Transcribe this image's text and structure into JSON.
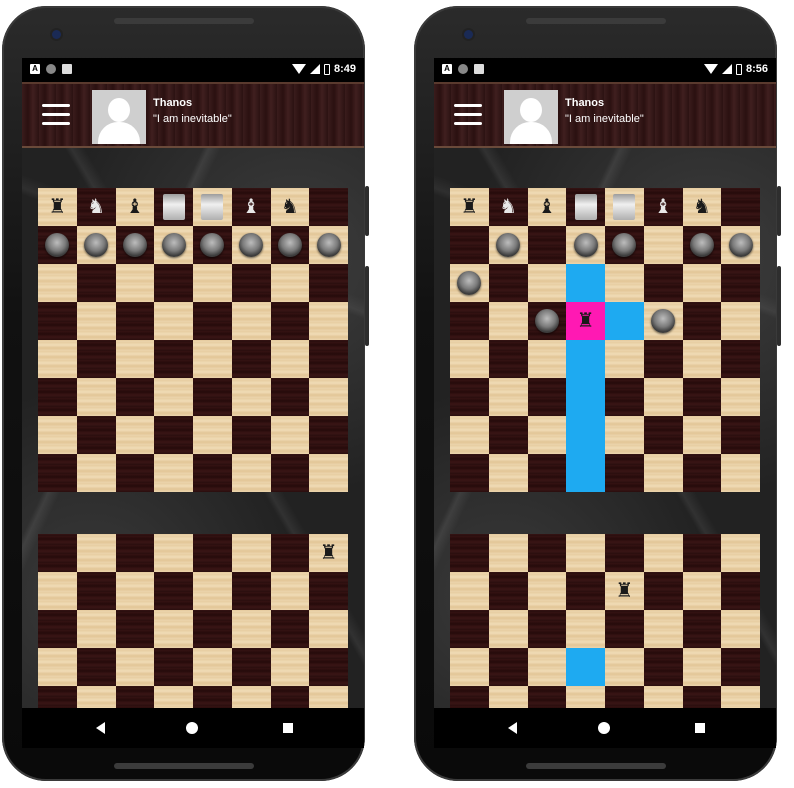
{
  "phones": [
    {
      "status": {
        "time": "8:49",
        "a_badge": "A"
      },
      "profile": {
        "name": "Thanos",
        "quote": "\"I am inevitable\""
      },
      "top_board": [
        [
          "rook",
          "bird",
          "bishop",
          "portrait",
          "portrait",
          "bishop",
          "bird",
          ""
        ],
        [
          "soldier",
          "soldier",
          "soldier",
          "soldier",
          "soldier",
          "soldier",
          "soldier",
          "soldier"
        ],
        [
          "",
          "",
          "",
          "",
          "",
          "",
          "",
          ""
        ],
        [
          "",
          "",
          "",
          "",
          "",
          "",
          "",
          ""
        ],
        [
          "",
          "",
          "",
          "",
          "",
          "",
          "",
          ""
        ],
        [
          "",
          "",
          "",
          "",
          "",
          "",
          "",
          ""
        ],
        [
          "",
          "",
          "",
          "",
          "",
          "",
          "",
          ""
        ],
        [
          "",
          "",
          "",
          "",
          "",
          "",
          "",
          ""
        ]
      ],
      "top_highlights": [],
      "bottom_board": [
        [
          "",
          "",
          "",
          "",
          "",
          "",
          "",
          "rook"
        ],
        [
          "",
          "",
          "",
          "",
          "",
          "",
          "",
          ""
        ],
        [
          "",
          "",
          "",
          "",
          "",
          "",
          "",
          ""
        ],
        [
          "",
          "",
          "",
          "",
          "",
          "",
          "",
          ""
        ],
        [
          "",
          "",
          "",
          "",
          "",
          "",
          "",
          ""
        ]
      ],
      "bottom_highlights": []
    },
    {
      "status": {
        "time": "8:56",
        "a_badge": "A"
      },
      "profile": {
        "name": "Thanos",
        "quote": "\"I am inevitable\""
      },
      "top_board": [
        [
          "rook",
          "bird",
          "bishop",
          "portrait",
          "portrait",
          "bishop",
          "bird",
          ""
        ],
        [
          "",
          "soldier",
          "",
          "soldier",
          "soldier",
          "",
          "soldier",
          "soldier"
        ],
        [
          "soldier",
          "",
          "",
          "",
          "",
          "",
          "",
          ""
        ],
        [
          "",
          "",
          "soldier",
          "rook",
          "",
          "soldier",
          "",
          ""
        ],
        [
          "",
          "",
          "",
          "",
          "",
          "",
          "",
          ""
        ],
        [
          "",
          "",
          "",
          "",
          "",
          "",
          "",
          ""
        ],
        [
          "",
          "",
          "",
          "",
          "",
          "",
          "",
          ""
        ],
        [
          "",
          "",
          "",
          "",
          "",
          "",
          "",
          ""
        ]
      ],
      "top_highlights": [
        {
          "row": 2,
          "col": 3,
          "color": "cyan"
        },
        {
          "row": 3,
          "col": 3,
          "color": "magenta"
        },
        {
          "row": 3,
          "col": 4,
          "color": "cyan"
        },
        {
          "row": 4,
          "col": 3,
          "color": "cyan"
        },
        {
          "row": 5,
          "col": 3,
          "color": "cyan"
        },
        {
          "row": 6,
          "col": 3,
          "color": "cyan"
        },
        {
          "row": 7,
          "col": 3,
          "color": "cyan"
        }
      ],
      "bottom_board": [
        [
          "",
          "",
          "",
          "",
          "",
          "",
          "",
          ""
        ],
        [
          "",
          "",
          "",
          "",
          "rook",
          "",
          "",
          ""
        ],
        [
          "",
          "",
          "",
          "",
          "",
          "",
          "",
          ""
        ],
        [
          "",
          "",
          "",
          "",
          "",
          "",
          "",
          ""
        ],
        [
          "",
          "",
          "",
          "",
          "",
          "",
          "",
          ""
        ]
      ],
      "bottom_highlights": [
        {
          "row": 3,
          "col": 3,
          "color": "cyan"
        }
      ]
    }
  ],
  "piece_glyphs": {
    "rook": "♜",
    "bird": "♞",
    "bishop": "♝"
  },
  "colors": {
    "highlight_cyan": "#1eaaf1",
    "highlight_magenta": "#ff19b3"
  }
}
